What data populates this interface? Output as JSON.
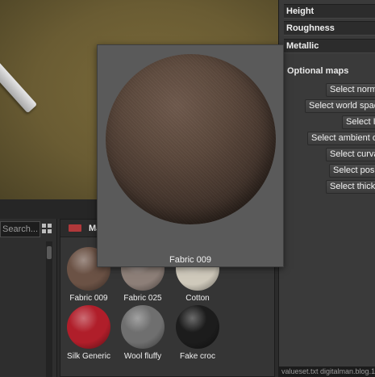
{
  "properties_panel": {
    "rows": [
      "Height",
      "Roughness",
      "Metallic"
    ],
    "optional_maps_title": "Optional maps",
    "buttons": [
      "Select normal",
      "Select world space",
      "Select ID",
      "Select ambient occlusion",
      "Select curvature",
      "Select position",
      "Select thickness"
    ]
  },
  "browser": {
    "search_placeholder": "Search..."
  },
  "materials": {
    "tab_label": "Materials",
    "swatch_color": "#b1383a",
    "items": [
      {
        "name": "Fabric 009",
        "color": "#6b5245"
      },
      {
        "name": "Fabric 025",
        "color": "#8d7f78"
      },
      {
        "name": "Cotton",
        "color": "#cfc9bb"
      },
      {
        "name": "Silk Generic",
        "color": "#b01e2a"
      },
      {
        "name": "Wool fluffy",
        "color": "#6f6f6f"
      },
      {
        "name": "Fake croc",
        "color": "#1c1c1c"
      }
    ]
  },
  "preview": {
    "label": "Fabric 009"
  },
  "status": {
    "text": "valueset.txt  digitalman.blog.163.com"
  }
}
